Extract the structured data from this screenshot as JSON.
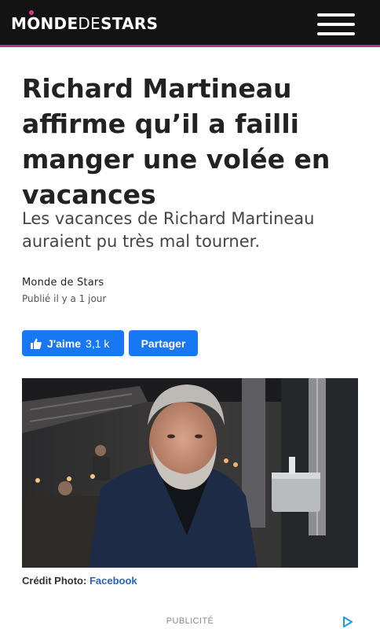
{
  "header": {
    "logo": {
      "part1": "M",
      "part2": "NDE",
      "middle": "DE",
      "part3": "STARS"
    },
    "accent_color": "#a23e83",
    "menu_icon": "hamburger-icon"
  },
  "article": {
    "title": "Richard Martineau affirme qu’il a failli manger une volée en vacances",
    "subtitle": "Les vacances de Richard Martineau auraient pu très mal tourner.",
    "author": "Monde de Stars",
    "published": "Publié il y a 1 jour"
  },
  "social": {
    "like_label": "J'aime",
    "like_count": "3,1 k",
    "share_label": "Partager",
    "button_color": "#1877f2",
    "like_icon": "thumbs-up-icon"
  },
  "photo": {
    "credit_label": "Crédit Photo:",
    "credit_source": "Facebook"
  },
  "ad": {
    "label": "PUBLICITÉ",
    "icon": "adchoices-icon"
  }
}
